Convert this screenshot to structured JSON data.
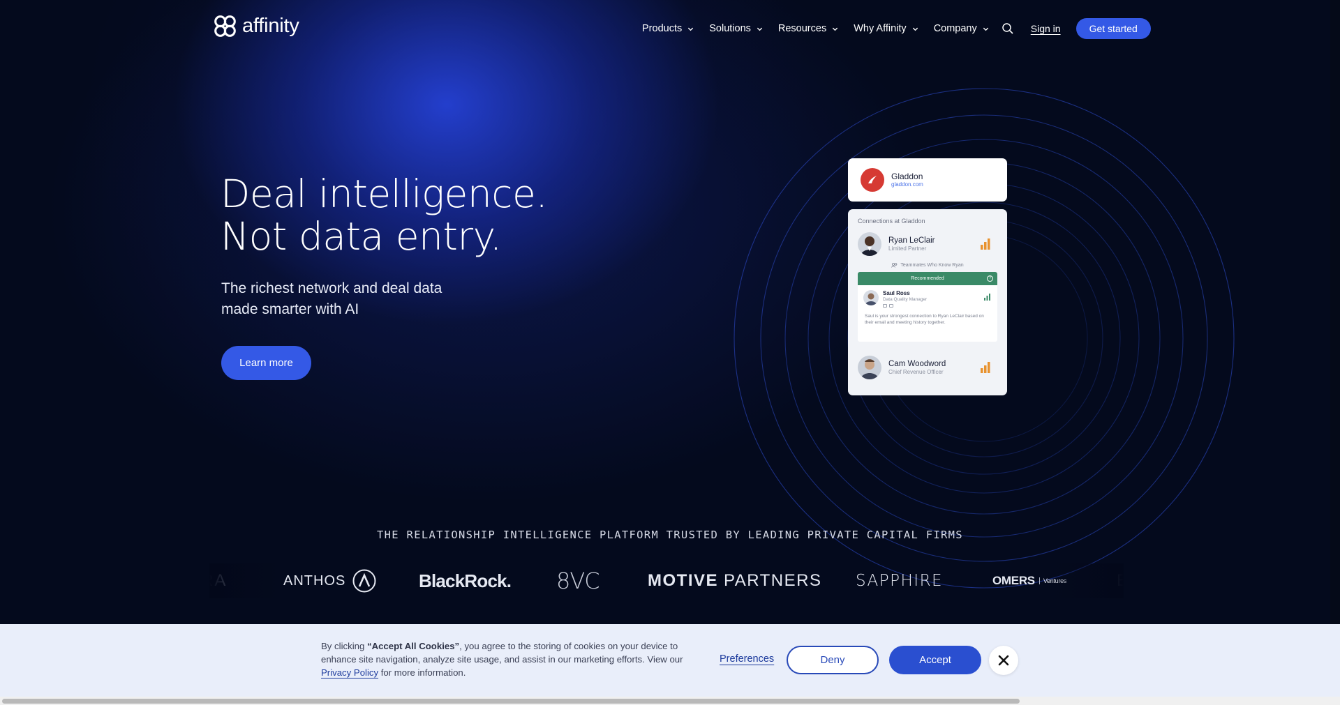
{
  "header": {
    "logo_text": "affinity",
    "nav": [
      {
        "label": "Products"
      },
      {
        "label": "Solutions"
      },
      {
        "label": "Resources"
      },
      {
        "label": "Why Affinity"
      },
      {
        "label": "Company"
      }
    ],
    "sign_in": "Sign in",
    "get_started": "Get started"
  },
  "hero": {
    "title_line1": "Deal intelligence.",
    "title_line2": "Not data entry.",
    "subtitle_line1": "The richest network and deal data",
    "subtitle_line2": "made smarter with AI",
    "cta": "Learn more"
  },
  "card": {
    "company_name": "Gladdon",
    "company_url": "gladdon.com",
    "connections_title": "Connections at Gladdon",
    "person1": {
      "name": "Ryan LeClair",
      "role": "Limited Partner"
    },
    "teammates_label": "Teammates Who Know Ryan",
    "recommended_label": "Recommended",
    "rec_person": {
      "name": "Saul Ross",
      "role": "Data Quality Manager"
    },
    "rec_note": "Saul is your strongest connection to Ryan LeClair based on their email and meeting history together.",
    "person2": {
      "name": "Cam Woodword",
      "role": "Chief Revenue Officer"
    }
  },
  "trusted": {
    "tagline": "THE RELATIONSHIP INTELLIGENCE PLATFORM TRUSTED BY LEADING PRIVATE CAPITAL FIRMS",
    "logos": {
      "ra": "RA",
      "anthos": "ANTHOS",
      "blackrock": "BlackRock.",
      "eightvc": "8VC",
      "motive_1": "MOTIVE",
      "motive_2": "PARTNERS",
      "sapphire": "SAPPHIRE",
      "omers": "OMERS",
      "omers_sub": "Ventures",
      "e": "E"
    }
  },
  "cookie": {
    "text_before": "By clicking ",
    "text_bold": "“Accept All Cookies”",
    "text_after": ", you agree to the storing of cookies on your device to enhance site navigation, analyze site usage, and assist in our marketing efforts. View our ",
    "privacy_link": "Privacy Policy",
    "text_end": " for more information.",
    "preferences": "Preferences",
    "deny": "Deny",
    "accept": "Accept"
  },
  "colors": {
    "accent": "#3459e6",
    "background": "#03081a",
    "cookie_bg": "#e9eefa",
    "recommended": "#3a8a67",
    "signal": "#e8922f"
  },
  "icons": {
    "logo": "affinity-knot-icon",
    "search": "search-icon",
    "chevron": "chevron-down-icon",
    "close": "close-icon"
  }
}
